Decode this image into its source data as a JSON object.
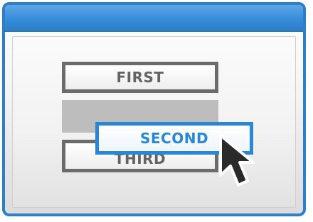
{
  "list": {
    "items": [
      {
        "label": "FIRST"
      },
      {
        "label": "SECOND"
      },
      {
        "label": "THIRD"
      }
    ]
  },
  "state": {
    "dragging_label": "SECOND"
  },
  "colors": {
    "window_border": "#2c80c9",
    "title_bar": "#3a8fdb",
    "item_border": "#6b6b6b",
    "drag_accent": "#2a87d6",
    "placeholder": "#bdbdbd"
  },
  "icons": {
    "cursor": "mouse-pointer-icon"
  }
}
